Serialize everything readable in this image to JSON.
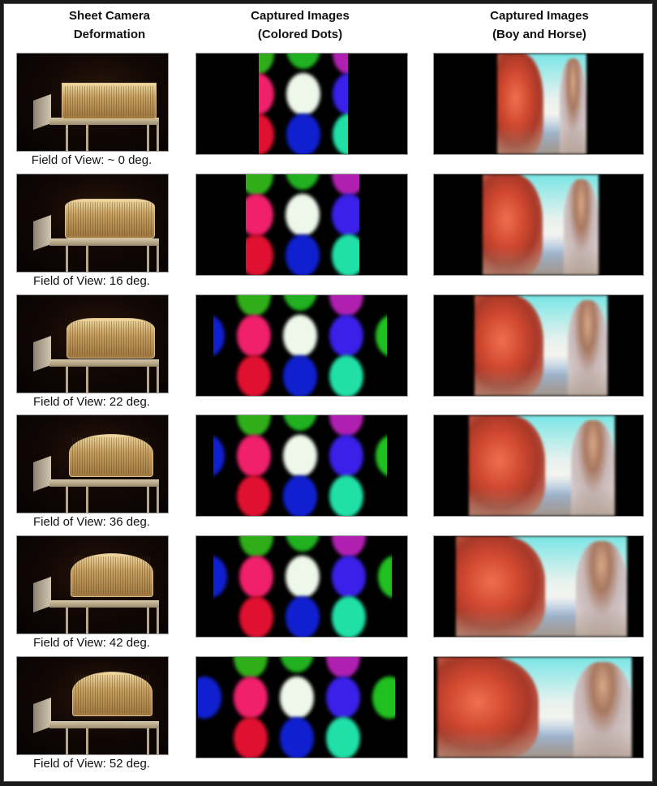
{
  "headers": {
    "col1": [
      "Sheet Camera",
      "Deformation"
    ],
    "col2": [
      "Captured Images",
      "(Colored Dots)"
    ],
    "col3": [
      "Captured Images",
      "(Boy and Horse)"
    ]
  },
  "rows": [
    {
      "caption": "Field of View: ~ 0 deg.",
      "fov_deg": 0
    },
    {
      "caption": "Field of View: 16 deg.",
      "fov_deg": 16
    },
    {
      "caption": "Field of View: 22 deg.",
      "fov_deg": 22
    },
    {
      "caption": "Field of View: 36 deg.",
      "fov_deg": 36
    },
    {
      "caption": "Field of View: 42 deg.",
      "fov_deg": 42
    },
    {
      "caption": "Field of View: 52 deg.",
      "fov_deg": 52
    }
  ],
  "images": {
    "sheet_camera": "photo of curved sheet camera on metal stand",
    "colored_dots": "captured image of colored dots pattern",
    "boy_horse": "captured image of boy and horse"
  },
  "colors": {
    "dot_palette": [
      "#2fae1a",
      "#20b020",
      "#b020b0",
      "#f0206a",
      "#eef8ea",
      "#3a20e8",
      "#e01030",
      "#1020d0",
      "#20e0a8"
    ]
  }
}
